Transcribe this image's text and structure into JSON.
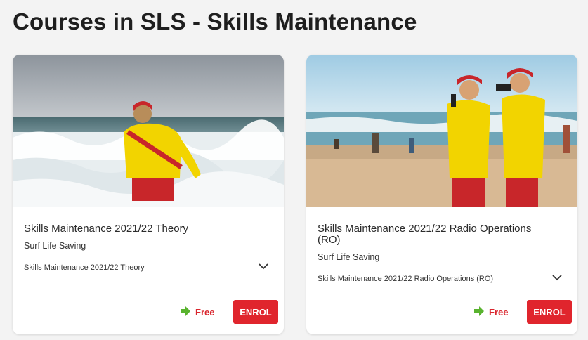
{
  "page": {
    "title": "Courses in SLS - Skills Maintenance"
  },
  "colors": {
    "accent": "#e0252d",
    "price_icon": "#59b32f"
  },
  "courses": [
    {
      "title": "Skills Maintenance 2021/22 Theory",
      "organisation": "Surf Life Saving",
      "description": "Skills Maintenance 2021/22 Theory",
      "price": "Free",
      "price_icon": "arrow-right-icon",
      "button_label": "ENROL",
      "expand_icon": "chevron-down-icon",
      "image": "lifeguard-in-surf-photo"
    },
    {
      "title": "Skills Maintenance 2021/22 Radio Operations (RO)",
      "organisation": "Surf Life Saving",
      "description": "Skills Maintenance 2021/22 Radio Operations (RO)",
      "price": "Free",
      "price_icon": "arrow-right-icon",
      "button_label": "ENROL",
      "expand_icon": "chevron-down-icon",
      "image": "lifeguards-on-beach-photo"
    }
  ]
}
